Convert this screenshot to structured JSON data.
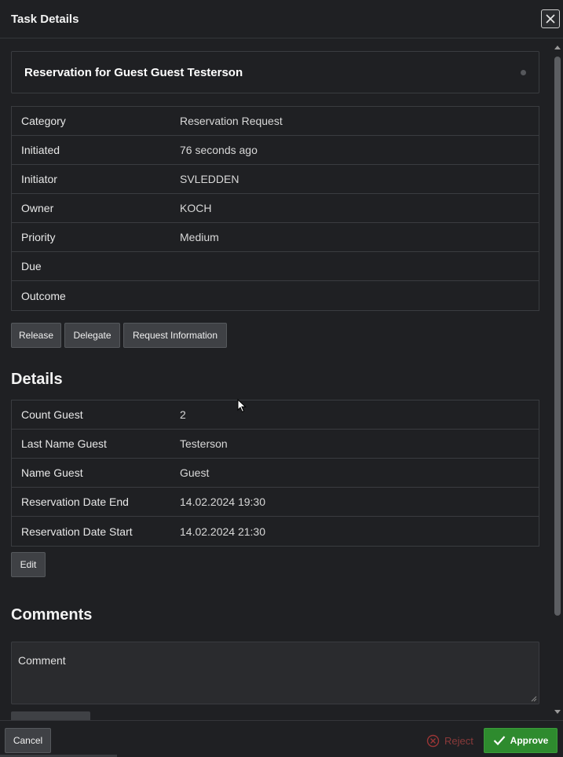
{
  "dialog": {
    "title": "Task Details",
    "close_icon": "close-icon"
  },
  "task": {
    "heading": "Reservation for Guest Guest Testerson"
  },
  "properties": [
    {
      "label": "Category",
      "value": "Reservation Request"
    },
    {
      "label": "Initiated",
      "value": "76 seconds ago"
    },
    {
      "label": "Initiator",
      "value": "SVLEDDEN"
    },
    {
      "label": "Owner",
      "value": "KOCH"
    },
    {
      "label": "Priority",
      "value": "Medium"
    },
    {
      "label": "Due",
      "value": ""
    },
    {
      "label": "Outcome",
      "value": ""
    }
  ],
  "actions": {
    "release": "Release",
    "delegate": "Delegate",
    "request_information": "Request Information"
  },
  "details": {
    "title": "Details",
    "rows": [
      {
        "label": "Count Guest",
        "value": "2"
      },
      {
        "label": "Last Name Guest",
        "value": "Testerson"
      },
      {
        "label": "Name Guest",
        "value": "Guest"
      },
      {
        "label": "Reservation Date End",
        "value": "14.02.2024 19:30"
      },
      {
        "label": "Reservation Date Start",
        "value": "14.02.2024 21:30"
      }
    ],
    "edit_label": "Edit"
  },
  "comments": {
    "title": "Comments",
    "placeholder": "Comment"
  },
  "footer": {
    "cancel": "Cancel",
    "reject": "Reject",
    "approve": "Approve",
    "approve_color": "#2e8b2e",
    "reject_color": "#8a3a3a"
  }
}
